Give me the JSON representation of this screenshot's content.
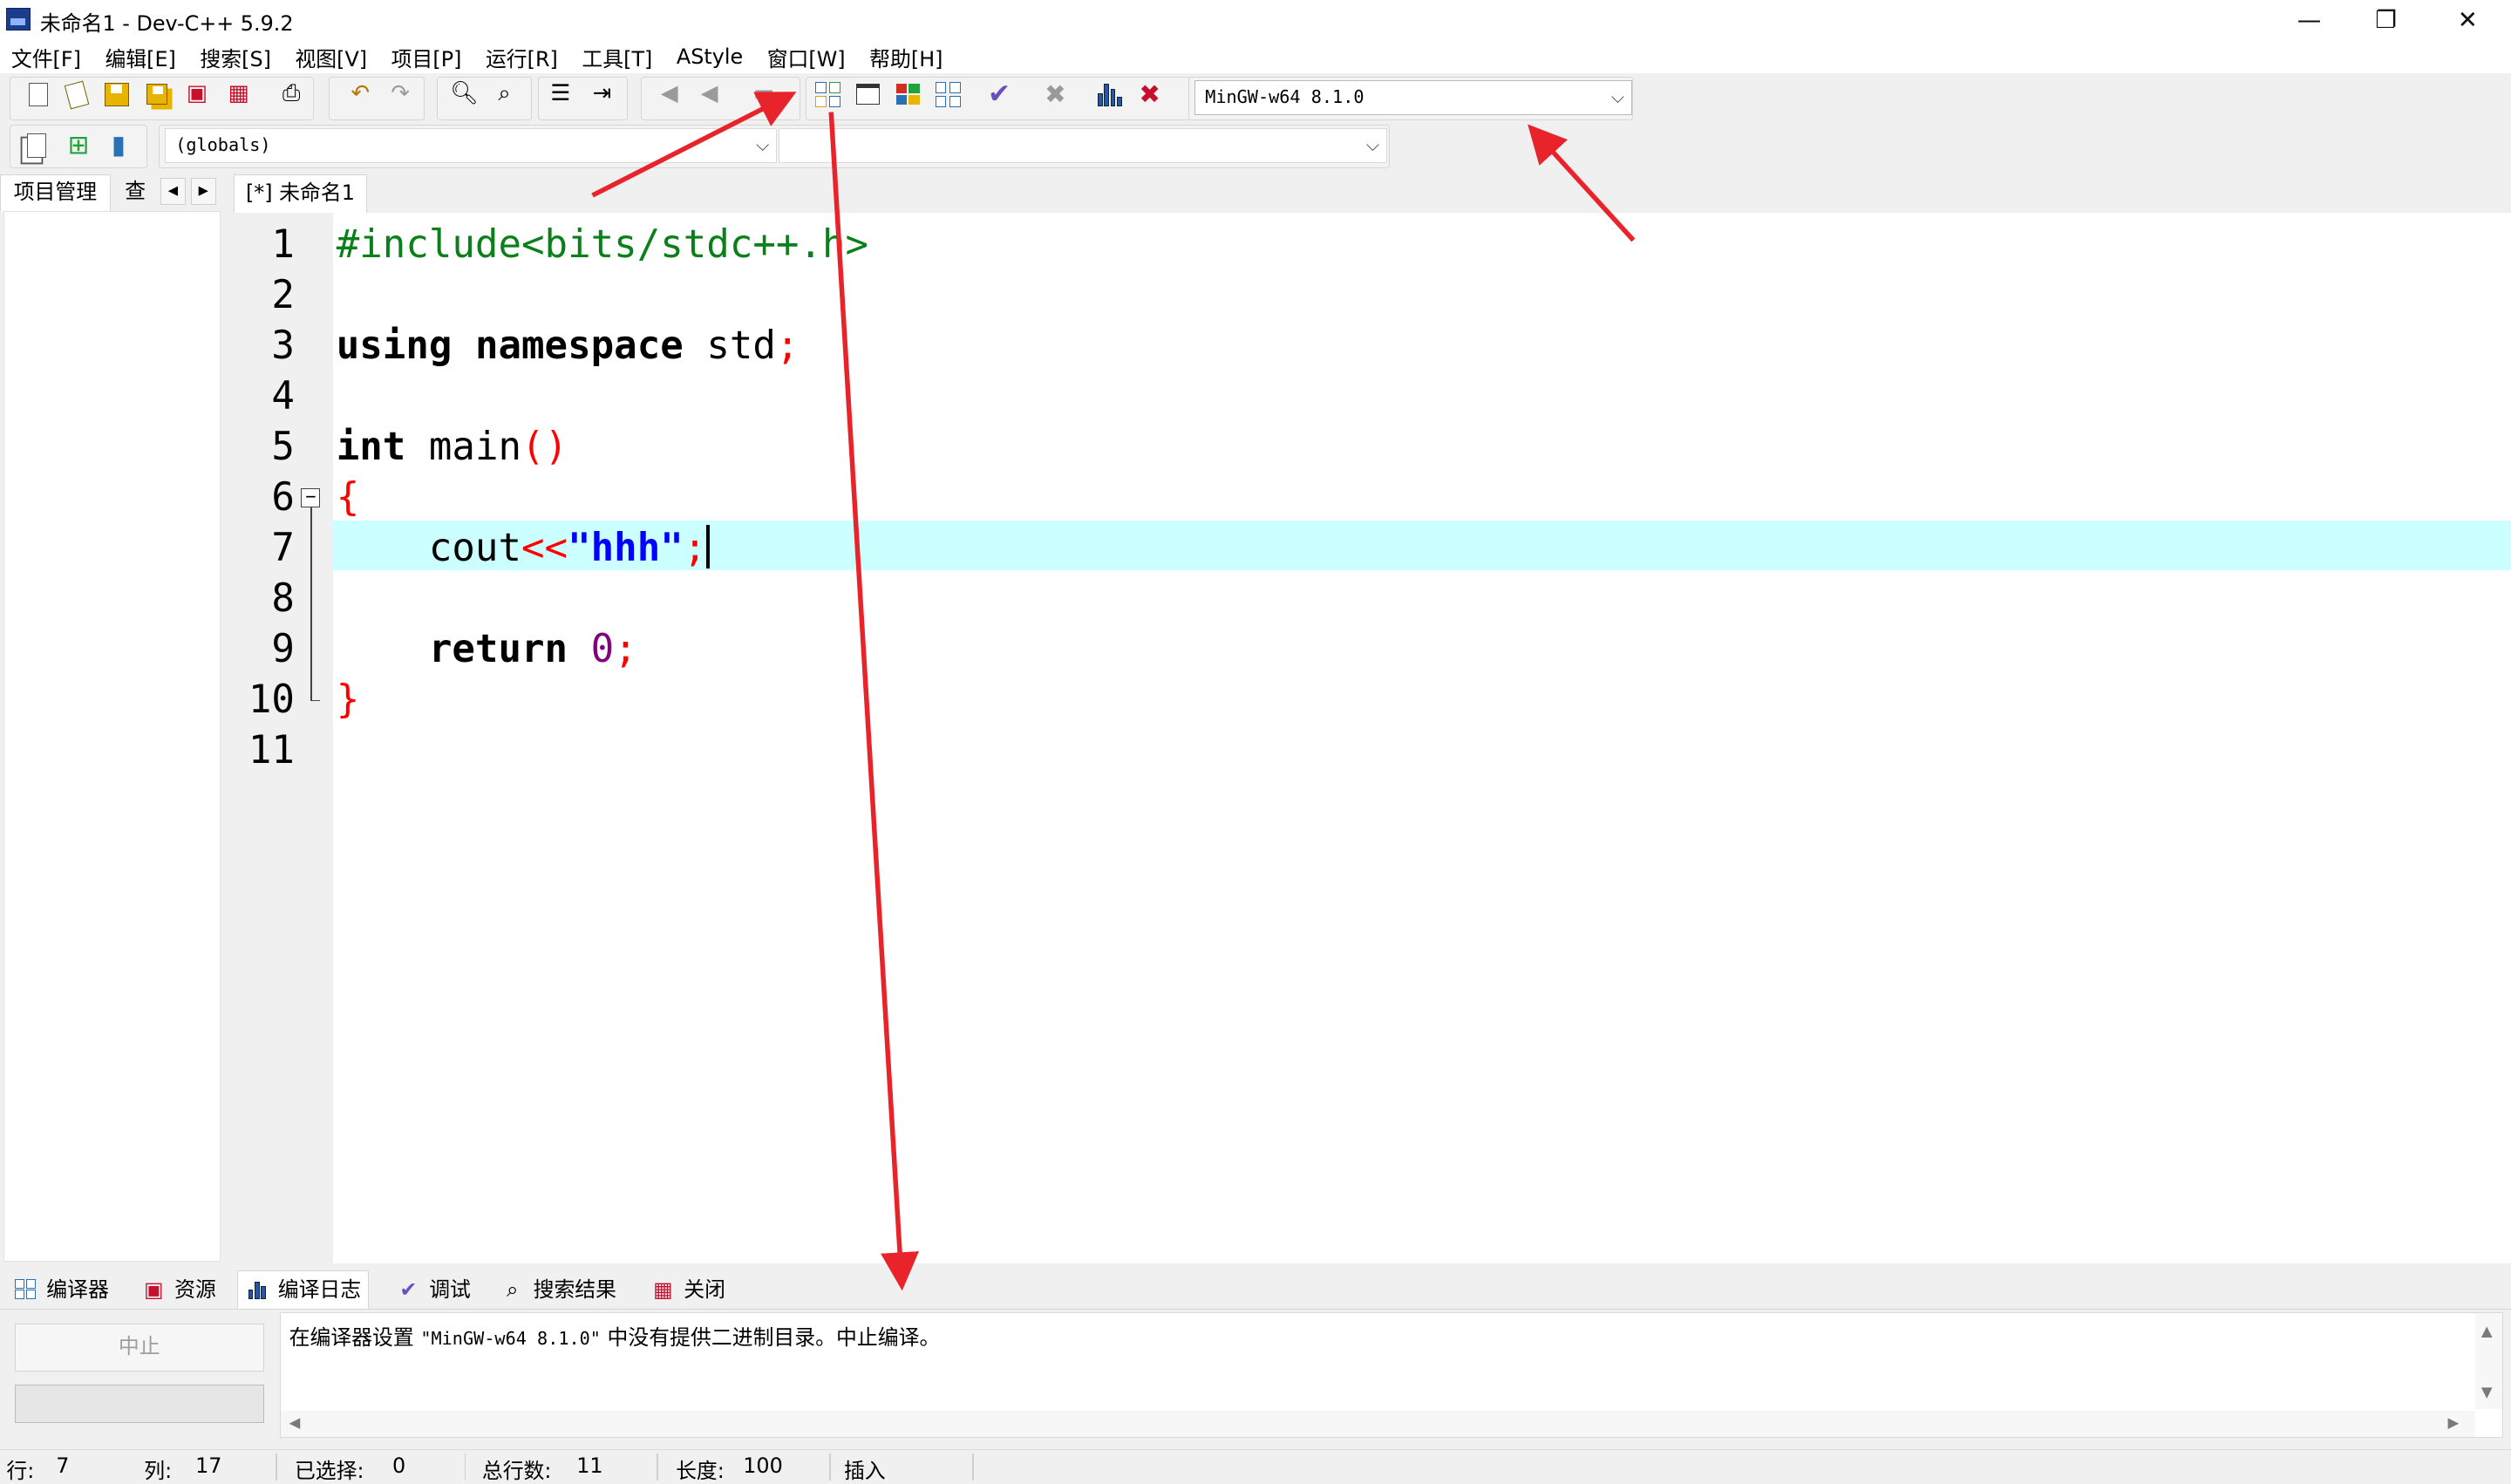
{
  "window": {
    "title": "未命名1 - Dev-C++ 5.9.2",
    "minimize_glyph": "—",
    "maximize_glyph": "❐",
    "close_glyph": "✕"
  },
  "menu": [
    "文件[F]",
    "编辑[E]",
    "搜索[S]",
    "视图[V]",
    "项目[P]",
    "运行[R]",
    "工具[T]",
    "AStyle",
    "窗口[W]",
    "帮助[H]"
  ],
  "toolbar": {
    "compiler_select": "MinGW-w64 8.1.0",
    "scope_select": "(globals)",
    "function_select": ""
  },
  "left_tabs": {
    "project": "项目管理",
    "view": "查看"
  },
  "editor": {
    "tab_label": "[*] 未命名1",
    "current_line": 7,
    "line_numbers": [
      "1",
      "2",
      "3",
      "4",
      "5",
      "6",
      "7",
      "8",
      "9",
      "10",
      "11"
    ],
    "code": {
      "l1": "#include<bits/stdc++.h>",
      "l3_kw1": "using",
      "l3_kw2": "namespace",
      "l3_id": "std",
      "l3_sym": ";",
      "l5_kw": "int",
      "l5_id": "main",
      "l5_sym": "()",
      "l6_sym": "{",
      "l7_id": "cout",
      "l7_op": "<<",
      "l7_str": "\"hhh\"",
      "l7_sym": ";",
      "l9_kw": "return",
      "l9_num": "0",
      "l9_sym": ";",
      "l10_sym": "}"
    },
    "fold_glyph": "−"
  },
  "bottom_tabs": [
    "编译器",
    "资源",
    "编译日志",
    "调试",
    "搜索结果",
    "关闭"
  ],
  "bottom_panel": {
    "abort_button": "中止",
    "log_prefix": "在编译器设置 ",
    "log_compiler": "\"MinGW-w64 8.1.0\"",
    "log_suffix": " 中没有提供二进制目录。中止编译。"
  },
  "status": {
    "row_label": "行:",
    "row_value": "7",
    "col_label": "列:",
    "col_value": "17",
    "sel_label": "已选择:",
    "sel_value": "0",
    "lines_label": "总行数:",
    "lines_value": "11",
    "len_label": "长度:",
    "len_value": "100",
    "mode": "插入"
  },
  "colors": {
    "annotation_arrow": "#e8242a",
    "current_line": "#ccffff",
    "preprocessor": "#098019",
    "string": "#0000ff",
    "symbol": "#ff0000",
    "number": "#800080"
  }
}
